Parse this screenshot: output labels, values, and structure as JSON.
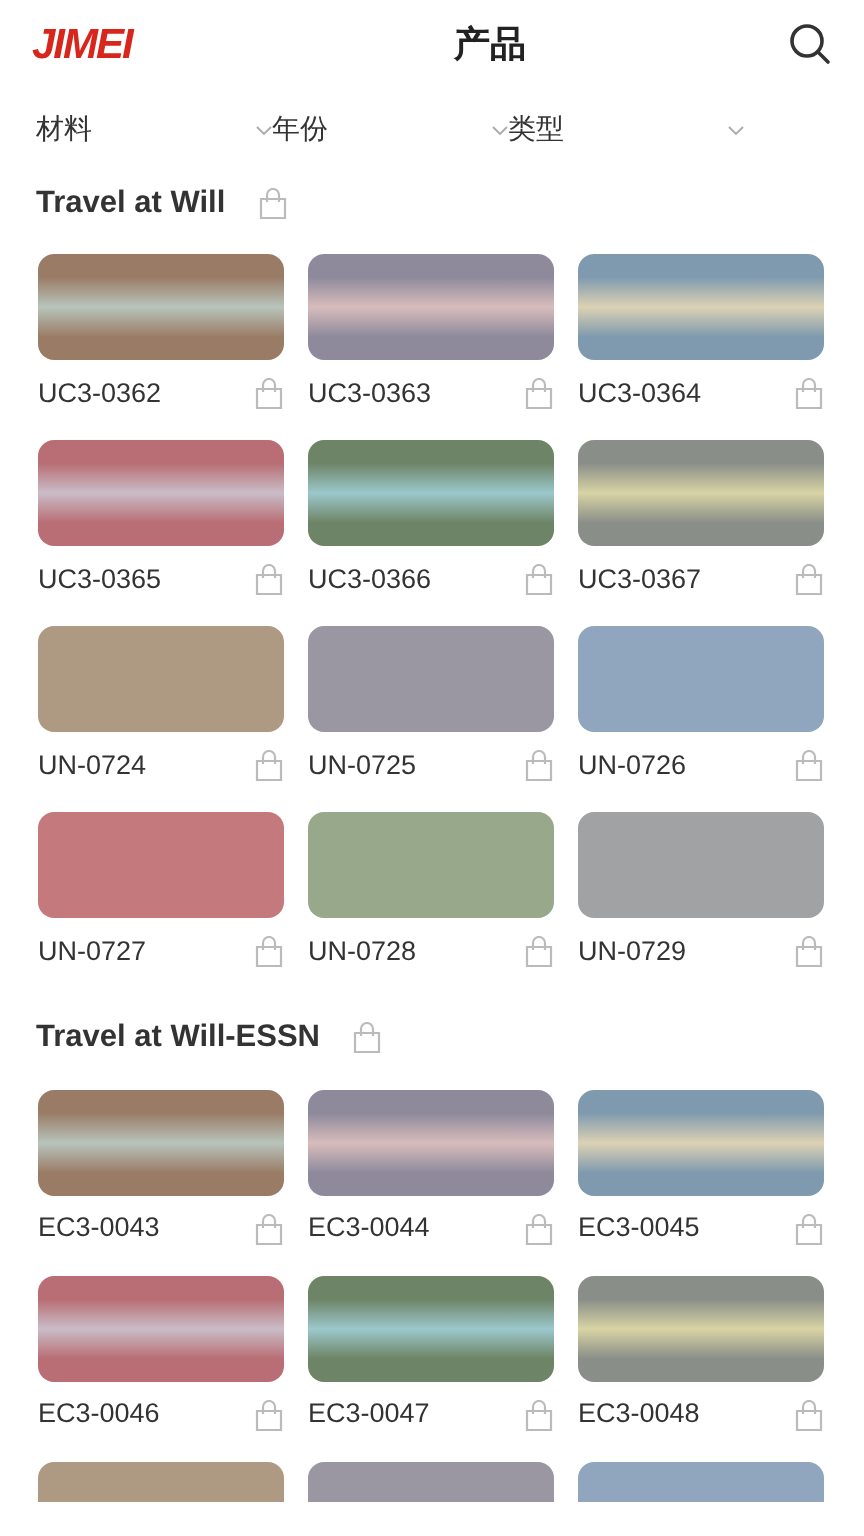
{
  "header": {
    "logo": "JIMEI",
    "title": "产品"
  },
  "filters": [
    {
      "label": "材料"
    },
    {
      "label": "年份"
    },
    {
      "label": "类型"
    }
  ],
  "sections": [
    {
      "title": "Travel at Will",
      "items": [
        {
          "code": "UC3-0362",
          "color": "#9a7c66",
          "stripe": {
            "color": "#b8c4bc"
          }
        },
        {
          "code": "UC3-0363",
          "color": "#8e8a9c",
          "stripe": {
            "color": "#d8bcbc"
          }
        },
        {
          "code": "UC3-0364",
          "color": "#7f9aae",
          "stripe": {
            "color": "#dcd2b4"
          }
        },
        {
          "code": "UC3-0365",
          "color": "#b86e74",
          "stripe": {
            "color": "#cabdc8"
          }
        },
        {
          "code": "UC3-0366",
          "color": "#6e8466",
          "stripe": {
            "color": "#9cc8cc"
          }
        },
        {
          "code": "UC3-0367",
          "color": "#8a8e88",
          "stripe": {
            "color": "#d8d4a4"
          }
        },
        {
          "code": "UN-0724",
          "color": "#ae9a82"
        },
        {
          "code": "UN-0725",
          "color": "#9a96a2"
        },
        {
          "code": "UN-0726",
          "color": "#8fa6be"
        },
        {
          "code": "UN-0727",
          "color": "#c47a7c"
        },
        {
          "code": "UN-0728",
          "color": "#98a88a"
        },
        {
          "code": "UN-0729",
          "color": "#a0a2a4"
        }
      ]
    },
    {
      "title": "Travel at Will-ESSN",
      "items": [
        {
          "code": "EC3-0043",
          "color": "#9a7c66",
          "stripe": {
            "color": "#b8c4bc"
          }
        },
        {
          "code": "EC3-0044",
          "color": "#8e8a9c",
          "stripe": {
            "color": "#d8bcbc"
          }
        },
        {
          "code": "EC3-0045",
          "color": "#7f9aae",
          "stripe": {
            "color": "#dcd2b4"
          }
        },
        {
          "code": "EC3-0046",
          "color": "#b86e74",
          "stripe": {
            "color": "#cabdc8"
          }
        },
        {
          "code": "EC3-0047",
          "color": "#6e8466",
          "stripe": {
            "color": "#9cc8cc"
          }
        },
        {
          "code": "EC3-0048",
          "color": "#8a8e88",
          "stripe": {
            "color": "#d8d4a4"
          }
        },
        {
          "color": "#ae9a82"
        },
        {
          "color": "#9a96a2"
        },
        {
          "color": "#8fa6be"
        }
      ]
    }
  ]
}
